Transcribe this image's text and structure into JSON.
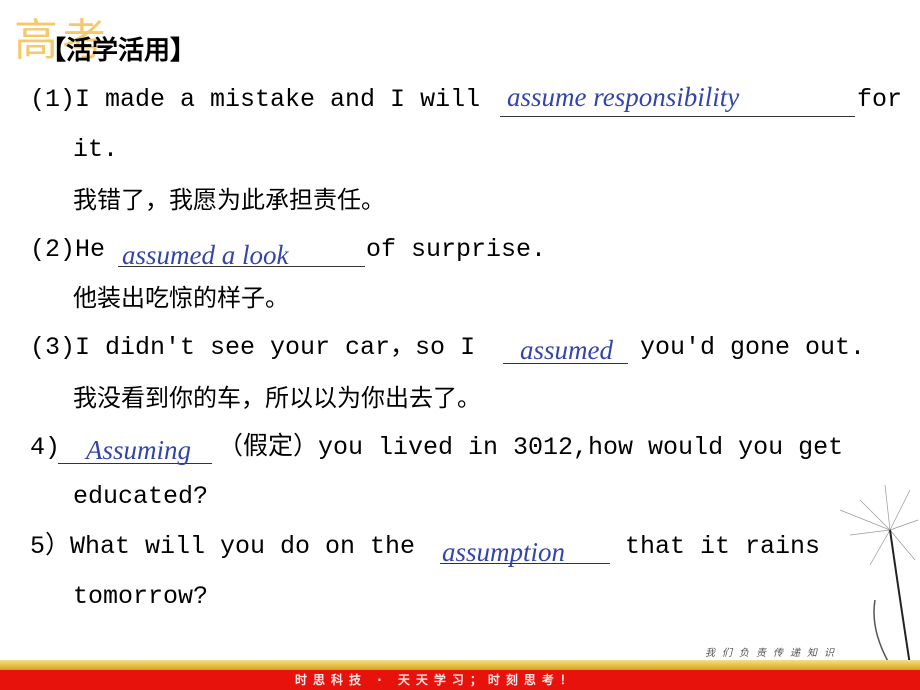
{
  "logo": {
    "text": "高考"
  },
  "heading": "【活学活用】",
  "items": [
    {
      "prefix": "(1)I made a mistake and I will",
      "answer": "assume responsibility",
      "suffix": "for",
      "cont": "it.",
      "translation": "我错了，我愿为此承担责任。"
    },
    {
      "prefix": "(2)He",
      "answer": "assumed a look",
      "suffix": "of surprise.",
      "translation": "他装出吃惊的样子。"
    },
    {
      "prefix": "(3)I didn't see your car，so I",
      "answer": "assumed",
      "suffix": "you'd gone out.",
      "translation": "我没看到你的车，所以以为你出去了。"
    },
    {
      "prefix": "4)",
      "answer": "Assuming",
      "suffix": "（假定）you lived in 3012,how would you get",
      "cont": "educated?"
    },
    {
      "prefix": "5）What will you do on the",
      "answer": "assumption",
      "suffix": "that it rains",
      "cont": "tomorrow?"
    }
  ],
  "footer": {
    "text": "时思科技 · 天天学习；时刻思考！",
    "slogan": "我们负责传递知识"
  },
  "colors": {
    "answer": "#3344aa",
    "footer_red": "#e8120c",
    "footer_gold": "#d6a414"
  }
}
